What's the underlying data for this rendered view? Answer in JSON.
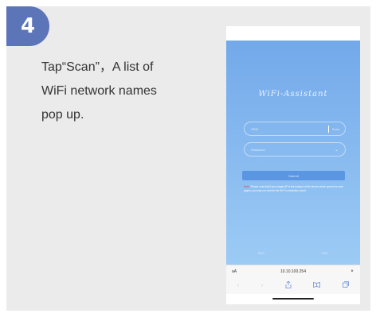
{
  "step": {
    "number": "4"
  },
  "instruction": "Tap“Scan”，A list of\nWiFi network names\npop up.",
  "phone": {
    "app_title": "WiFi-Assistant",
    "ssid_placeholder": "SSID",
    "scan_label": "Scan",
    "password_placeholder": "Password",
    "submit_label": "Submit",
    "note_label": "Note:",
    "note_text": "Please note that if your target AP is the hotspot of the device which opens the web pages, you may not receive the Wi-Fi connection result.",
    "footer_left": "Wi-Fi",
    "footer_right": "DOC",
    "browser": {
      "aa_label": "aA",
      "url": "10.10.100.254",
      "close_label": "×"
    }
  },
  "colors": {
    "badge": "#5c74b8",
    "screen_top": "#73a9ea",
    "screen_bottom": "#9ccbf5",
    "button": "#5b96e3"
  },
  "icons": [
    "back-icon",
    "forward-icon",
    "share-icon",
    "bookmarks-icon",
    "tabs-icon",
    "chevron-down-icon"
  ]
}
